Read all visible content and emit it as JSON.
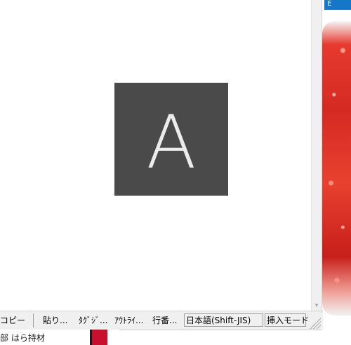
{
  "editor": {
    "tile_letter": "A"
  },
  "statusbar": {
    "copy": "コピー",
    "paste": "貼り...",
    "tag_jump": "ﾀｸﾞｼﾞ...",
    "outline": "ｱｳﾄﾗｲ...",
    "line_num": "行番...",
    "encoding": "日本語(Shift-JIS)",
    "insert_mode": "挿入モード"
  },
  "right_panel": {
    "tab_label": "E"
  },
  "below": {
    "text": "部 はら持材"
  },
  "colors": {
    "tile_bg": "#4a4a4a",
    "accent_blue": "#1676c8",
    "red": "#c8102e"
  }
}
